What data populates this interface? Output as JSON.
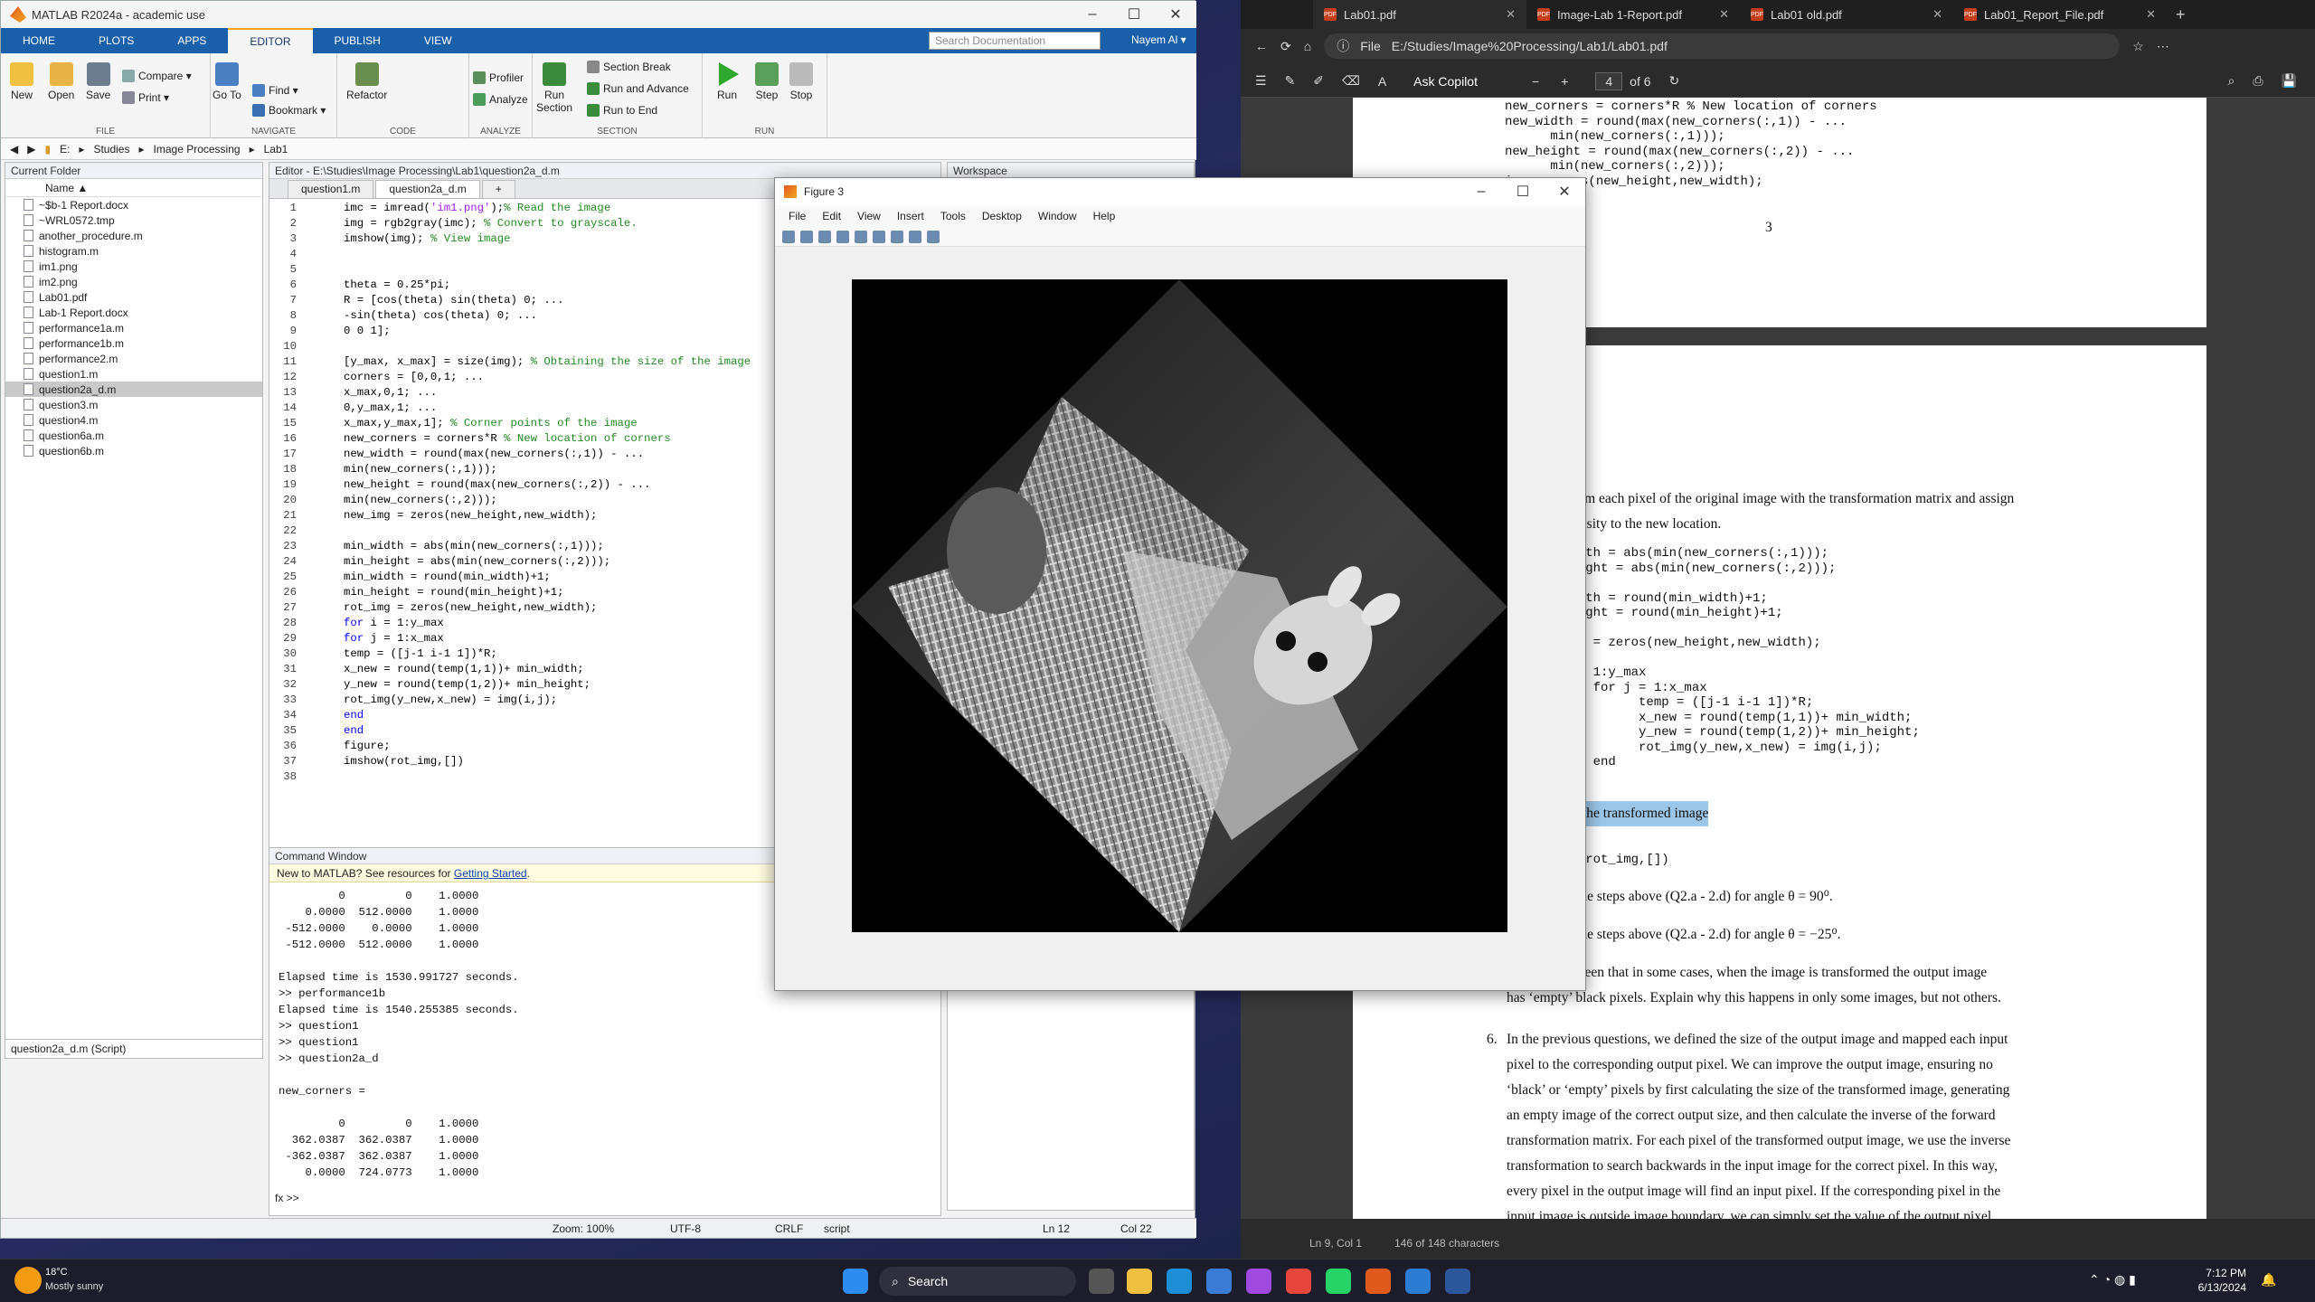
{
  "matlab": {
    "title": "MATLAB R2024a - academic use",
    "tabs": [
      "HOME",
      "PLOTS",
      "APPS",
      "EDITOR",
      "PUBLISH",
      "VIEW"
    ],
    "active_tab": "EDITOR",
    "search_placeholder": "Search Documentation",
    "user": "Nayem Al ▾",
    "ribbon": {
      "file": {
        "label": "FILE",
        "new": "New",
        "open": "Open",
        "save": "Save",
        "compare": "Compare ▾",
        "print": "Print ▾"
      },
      "navigate": {
        "label": "NAVIGATE",
        "goto": "Go To",
        "find": "Find ▾",
        "bookmark": "Bookmark ▾"
      },
      "code": {
        "label": "CODE",
        "refactor": "Refactor"
      },
      "analyze": {
        "label": "ANALYZE",
        "profiler": "Profiler",
        "analyze": "Analyze"
      },
      "section": {
        "label": "SECTION",
        "run_section": "Run Section",
        "section_break": "Section Break",
        "run_advance": "Run and Advance",
        "run_end": "Run to End"
      },
      "run": {
        "label": "RUN",
        "run": "Run",
        "step": "Step",
        "stop": "Stop"
      }
    },
    "address": [
      "E:",
      "Studies",
      "Image Processing",
      "Lab1"
    ],
    "current_folder": {
      "title": "Current Folder",
      "col_name": "Name ▲",
      "files": [
        "~$b-1 Report.docx",
        "~WRL0572.tmp",
        "another_procedure.m",
        "histogram.m",
        "im1.png",
        "im2.png",
        "Lab01.pdf",
        "Lab-1 Report.docx",
        "performance1a.m",
        "performance1b.m",
        "performance2.m",
        "question1.m",
        "question2a_d.m",
        "question3.m",
        "question4.m",
        "question6a.m",
        "question6b.m"
      ],
      "selected": "question2a_d.m",
      "detail": "question2a_d.m  (Script)"
    },
    "editor": {
      "title": "Editor - E:\\Studies\\Image Processing\\Lab1\\question2a_d.m",
      "tabs": [
        "question1.m",
        "question2a_d.m",
        "+"
      ],
      "lines": [
        [
          {
            "t": "imc = imread(",
            "c": "ct"
          },
          {
            "t": "'im1.png'",
            "c": "st"
          },
          {
            "t": ");",
            "c": "ct"
          },
          {
            "t": "% Read the image",
            "c": "cm"
          }
        ],
        [
          {
            "t": "img = rgb2gray(imc); ",
            "c": "ct"
          },
          {
            "t": "% Convert to grayscale.",
            "c": "cm"
          }
        ],
        [
          {
            "t": "imshow(img); ",
            "c": "ct"
          },
          {
            "t": "% View image",
            "c": "cm"
          }
        ],
        [],
        [],
        [
          {
            "t": "theta = 0.25*pi;",
            "c": "ct"
          }
        ],
        [
          {
            "t": "R = [cos(theta) sin(theta) 0; ...",
            "c": "ct"
          }
        ],
        [
          {
            "t": "-sin(theta) cos(theta) 0; ...",
            "c": "ct"
          }
        ],
        [
          {
            "t": "0 0 1];",
            "c": "ct"
          }
        ],
        [],
        [
          {
            "t": "[y_max, x_max] = size(img); ",
            "c": "ct"
          },
          {
            "t": "% Obtaining the size of the image",
            "c": "cm"
          }
        ],
        [
          {
            "t": "corners = [0,0,1; ...",
            "c": "ct"
          }
        ],
        [
          {
            "t": "x_max,0,1; ...",
            "c": "ct"
          }
        ],
        [
          {
            "t": "0,y_max,1; ...",
            "c": "ct"
          }
        ],
        [
          {
            "t": "x_max,y_max,1]; ",
            "c": "ct"
          },
          {
            "t": "% Corner points of the image",
            "c": "cm"
          }
        ],
        [
          {
            "t": "new_corners = corners*R ",
            "c": "ct"
          },
          {
            "t": "% New location of corners",
            "c": "cm"
          }
        ],
        [
          {
            "t": "new_width = round(max(new_corners(:,1)) - ...",
            "c": "ct"
          }
        ],
        [
          {
            "t": "min(new_corners(:,1)));",
            "c": "ct"
          }
        ],
        [
          {
            "t": "new_height = round(max(new_corners(:,2)) - ...",
            "c": "ct"
          }
        ],
        [
          {
            "t": "min(new_corners(:,2)));",
            "c": "ct"
          }
        ],
        [
          {
            "t": "new_img = zeros(new_height,new_width);",
            "c": "ct"
          }
        ],
        [],
        [
          {
            "t": "min_width = abs(min(new_corners(:,1)));",
            "c": "ct"
          }
        ],
        [
          {
            "t": "min_height = abs(min(new_corners(:,2)));",
            "c": "ct"
          }
        ],
        [
          {
            "t": "min_width = round(min_width)+1;",
            "c": "ct"
          }
        ],
        [
          {
            "t": "min_height = round(min_height)+1;",
            "c": "ct"
          }
        ],
        [
          {
            "t": "rot_img = zeros(new_height,new_width);",
            "c": "ct"
          }
        ],
        [
          {
            "t": "for ",
            "c": "kw"
          },
          {
            "t": "i = 1:y_max",
            "c": "ct"
          }
        ],
        [
          {
            "t": "for ",
            "c": "kw"
          },
          {
            "t": "j = 1:x_max",
            "c": "ct"
          }
        ],
        [
          {
            "t": "temp = ([j-1 i-1 1])*R;",
            "c": "ct"
          }
        ],
        [
          {
            "t": "x_new = round(temp(1,1))+ min_width;",
            "c": "ct"
          }
        ],
        [
          {
            "t": "y_new = round(temp(1,2))+ min_height;",
            "c": "ct"
          }
        ],
        [
          {
            "t": "rot_img(y_new,x_new) = img(i,j);",
            "c": "ct"
          }
        ],
        [
          {
            "t": "end",
            "c": "kw"
          }
        ],
        [
          {
            "t": "end",
            "c": "kw"
          }
        ],
        [
          {
            "t": "figure;",
            "c": "ct"
          }
        ],
        [
          {
            "t": "imshow(rot_img,[])",
            "c": "ct"
          }
        ],
        []
      ]
    },
    "workspace_title": "Workspace",
    "command_window": {
      "title": "Command Window",
      "info_prefix": "New to MATLAB? See resources for ",
      "info_link": "Getting Started",
      "info_suffix": ".",
      "text": "         0         0    1.0000\n    0.0000  512.0000    1.0000\n -512.0000    0.0000    1.0000\n -512.0000  512.0000    1.0000\n\nElapsed time is 1530.991727 seconds.\n>> performance1b\nElapsed time is 1540.255385 seconds.\n>> question1\n>> question1\n>> question2a_d\n\nnew_corners =\n\n         0         0    1.0000\n  362.0387  362.0387    1.0000\n -362.0387  362.0387    1.0000\n    0.0000  724.0773    1.0000\n",
      "prompt": "fx >>"
    },
    "status": {
      "zoom": "Zoom: 100%",
      "enc": "UTF-8",
      "eol": "CRLF",
      "type": "script",
      "ln": "Ln   12",
      "col": "Col   22"
    }
  },
  "figure": {
    "title": "Figure 3",
    "menu": [
      "File",
      "Edit",
      "View",
      "Insert",
      "Tools",
      "Desktop",
      "Window",
      "Help"
    ]
  },
  "browser": {
    "tabs": [
      {
        "label": "Lab01.pdf"
      },
      {
        "label": "Image-Lab 1-Report.pdf"
      },
      {
        "label": "Lab01 old.pdf"
      },
      {
        "label": "Lab01_Report_File.pdf"
      }
    ],
    "address_label": "File",
    "url": "E:/Studies/Image%20Processing/Lab1/Lab01.pdf",
    "pdf_toolbar": {
      "ask": "Ask Copilot",
      "page": "4",
      "of": "of 6"
    },
    "page3": {
      "code": "new_corners = corners*R % New location of corners\nnew_width = round(max(new_corners(:,1)) - ...\n      min(new_corners(:,1)));\nnew_height = round(max(new_corners(:,2)) - ...\n      min(new_corners(:,2)));\nimg = zeros(new_height,new_width);",
      "page_number": "3"
    },
    "page4": {
      "p1": "sform each pixel of the original image with the transformation matrix and assign",
      "p2": "ntensity to the new location.",
      "code1": "width = abs(min(new_corners(:,1)));\nheight = abs(min(new_corners(:,2)));\n\nwidth = round(min_width)+1;\nheight = round(min_height)+1;\n\nimg = zeros(new_height,new_width);\n\ni = 1:y_max\n    for j = 1:x_max\n          temp = ([j-1 i-1 1])*R;\n          x_new = round(temp(1,1))+ min_width;\n          y_new = round(temp(1,2))+ min_height;\n          rot_img(y_new,x_new) = img(i,j);\n    end",
      "highlight": "ew the transformed image",
      "code2": "re;\now(rot_img,[])",
      "s1": "te the steps above (Q2.a - 2.d) for angle θ = 90⁰.",
      "s2": "te the steps above (Q2.a - 2.d) for angle θ = −25⁰.",
      "s3a": "be seen that in some cases, when the image is transformed the output image",
      "s3b": "has ‘empty’ black pixels. Explain why this happens in only some images, but not others.",
      "item6": "6.",
      "q6": [
        "In the previous questions, we defined the size of the output image and mapped each input",
        "pixel to the corresponding output pixel. We can improve the output image, ensuring no",
        "‘black’ or ‘empty’ pixels by first calculating the size of the transformed image, generating",
        "an empty image of the correct output size, and then calculate the inverse of the forward",
        "transformation matrix. For each pixel of the transformed output image, we use the inverse",
        "transformation to search backwards in the input image for the correct pixel. In this way,",
        "every pixel in the output image will find an input pixel. If the corresponding pixel in the",
        "input image is outside image boundary, we can simply set the value of the output pixel"
      ]
    },
    "status": {
      "pos": "Ln 9, Col 1",
      "chars": "146 of 148 characters"
    }
  },
  "taskbar": {
    "weather_temp": "18°C",
    "weather_desc": "Mostly sunny",
    "search": "Search",
    "time": "7:12 PM",
    "date": "6/13/2024"
  }
}
